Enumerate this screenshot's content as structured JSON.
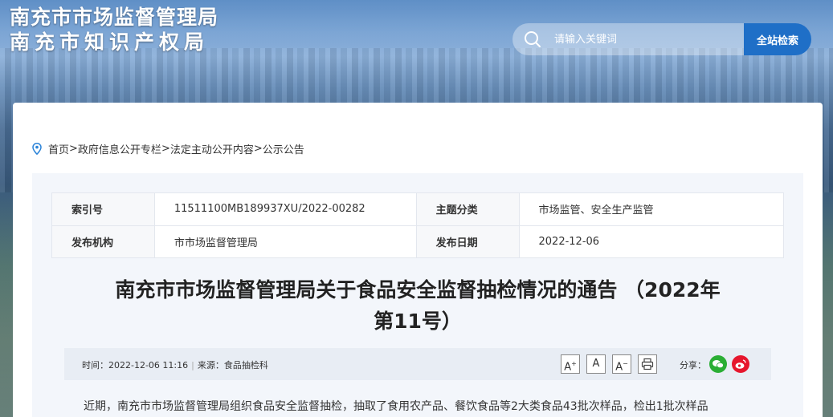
{
  "header": {
    "logo_line1": "南充市市场监督管理局",
    "logo_line2": "南充市知识产权局",
    "search_placeholder": "请输入关键词",
    "search_button": "全站检索"
  },
  "breadcrumb": {
    "items": [
      "首页",
      "政府信息公开专栏",
      "法定主动公开内容",
      "公示公告"
    ],
    "separator": ">"
  },
  "info": {
    "index_label": "索引号",
    "index_value": "11511100MB189937XU/2022-00282",
    "category_label": "主题分类",
    "category_value": "市场监管、安全生产监管",
    "publisher_label": "发布机构",
    "publisher_value": "市市场监督管理局",
    "date_label": "发布日期",
    "date_value": "2022-12-06"
  },
  "article": {
    "title_line1": "南充市市场监督管理局关于食品安全监督抽检情况的通告 （2022年",
    "title_line2": "第11号）",
    "time_text": "时间：2022-12-06 11:16",
    "source_text": "来源：食品抽检科",
    "font_large": "A",
    "font_medium": "A",
    "font_small": "A",
    "share_label": "分享：",
    "body_first_line": "近期，南充市市场监督管理局组织食品安全监督抽检，抽取了食用农产品、餐饮食品等2大类食品43批次样品，检出1批次样品"
  },
  "colors": {
    "accent": "#1f6fc7",
    "wechat": "#2aae34",
    "weibo": "#e6162d"
  }
}
